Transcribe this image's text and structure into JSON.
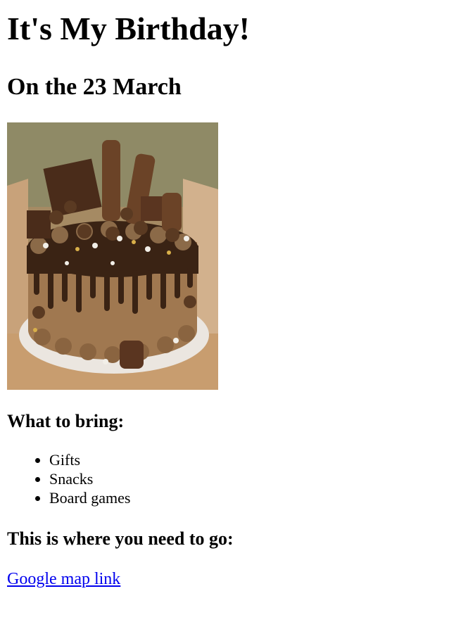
{
  "page": {
    "title": "It's My Birthday!",
    "date_heading": "On the 23 March",
    "bring_heading": "What to bring:",
    "bring_items": [
      "Gifts",
      "Snacks",
      "Board games"
    ],
    "where_heading": "This is where you need to go:",
    "map_link_label": "Google map link"
  },
  "colors": {
    "link": "#0000ee",
    "text": "#000000",
    "background": "#ffffff"
  }
}
